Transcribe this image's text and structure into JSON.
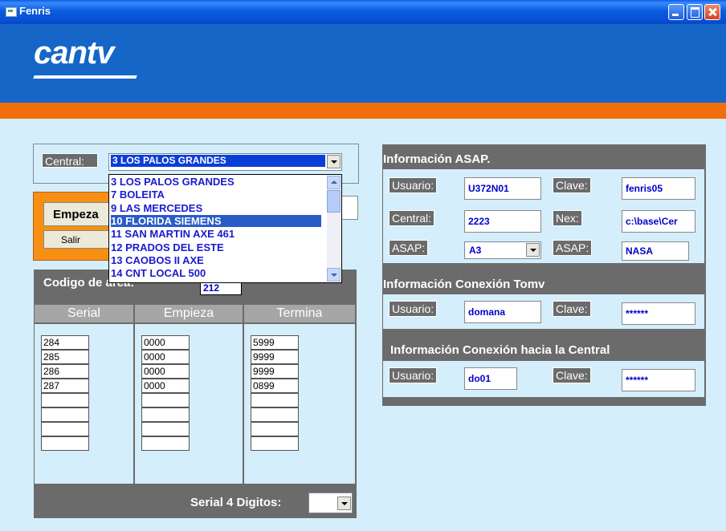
{
  "window": {
    "title": "Fenris"
  },
  "brand": {
    "logo": "cantv"
  },
  "central": {
    "label": "Central:",
    "selected": "3 LOS PALOS GRANDES",
    "options": [
      "3 LOS PALOS GRANDES",
      "7 BOLEITA",
      "9 LAS MERCEDES",
      "10 FLORIDA SIEMENS",
      "11 SAN MARTIN AXE 461",
      "12 PRADOS DEL ESTE",
      "13 CAOBOS II AXE",
      "14 CNT LOCAL 500"
    ],
    "highlighted_index": 3
  },
  "buttons": {
    "empieza": "Empeza",
    "salir": "Salir"
  },
  "codigo": {
    "label": "Codigo de área:",
    "value": "212"
  },
  "table": {
    "headers": [
      "Serial",
      "Empieza",
      "Termina"
    ],
    "serial": [
      "284",
      "285",
      "286",
      "287",
      "",
      "",
      "",
      ""
    ],
    "empieza": [
      "0000",
      "0000",
      "0000",
      "0000",
      "",
      "",
      "",
      ""
    ],
    "termina": [
      "5999",
      "9999",
      "9999",
      "0899",
      "",
      "",
      "",
      ""
    ]
  },
  "serial4": {
    "label": "Serial 4 Digitos:",
    "value": ""
  },
  "asap": {
    "title": "Información ASAP.",
    "usuario_label": "Usuario:",
    "usuario": "U372N01",
    "clave_label": "Clave:",
    "clave": "fenris05",
    "central_label": "Central:",
    "central": "2223",
    "nex_label": "Nex:",
    "nex": "c:\\base\\Cer",
    "asap_label": "ASAP:",
    "asap_combo": "A3",
    "asap2_label": "ASAP:",
    "asap_value": "NASA"
  },
  "tomv": {
    "title": "Información Conexión Tomv",
    "usuario_label": "Usuario:",
    "usuario": "domana",
    "clave_label": "Clave:",
    "clave": "******"
  },
  "central_conn": {
    "title": "Información Conexión hacia la Central",
    "usuario_label": "Usuario:",
    "usuario": "do01",
    "clave_label": "Clave:",
    "clave": "******"
  },
  "colors": {
    "header_blue": "#1566c6",
    "accent_orange": "#f06e0c",
    "form_bg": "#d4eefb",
    "panel_gray": "#6b6b6b"
  }
}
